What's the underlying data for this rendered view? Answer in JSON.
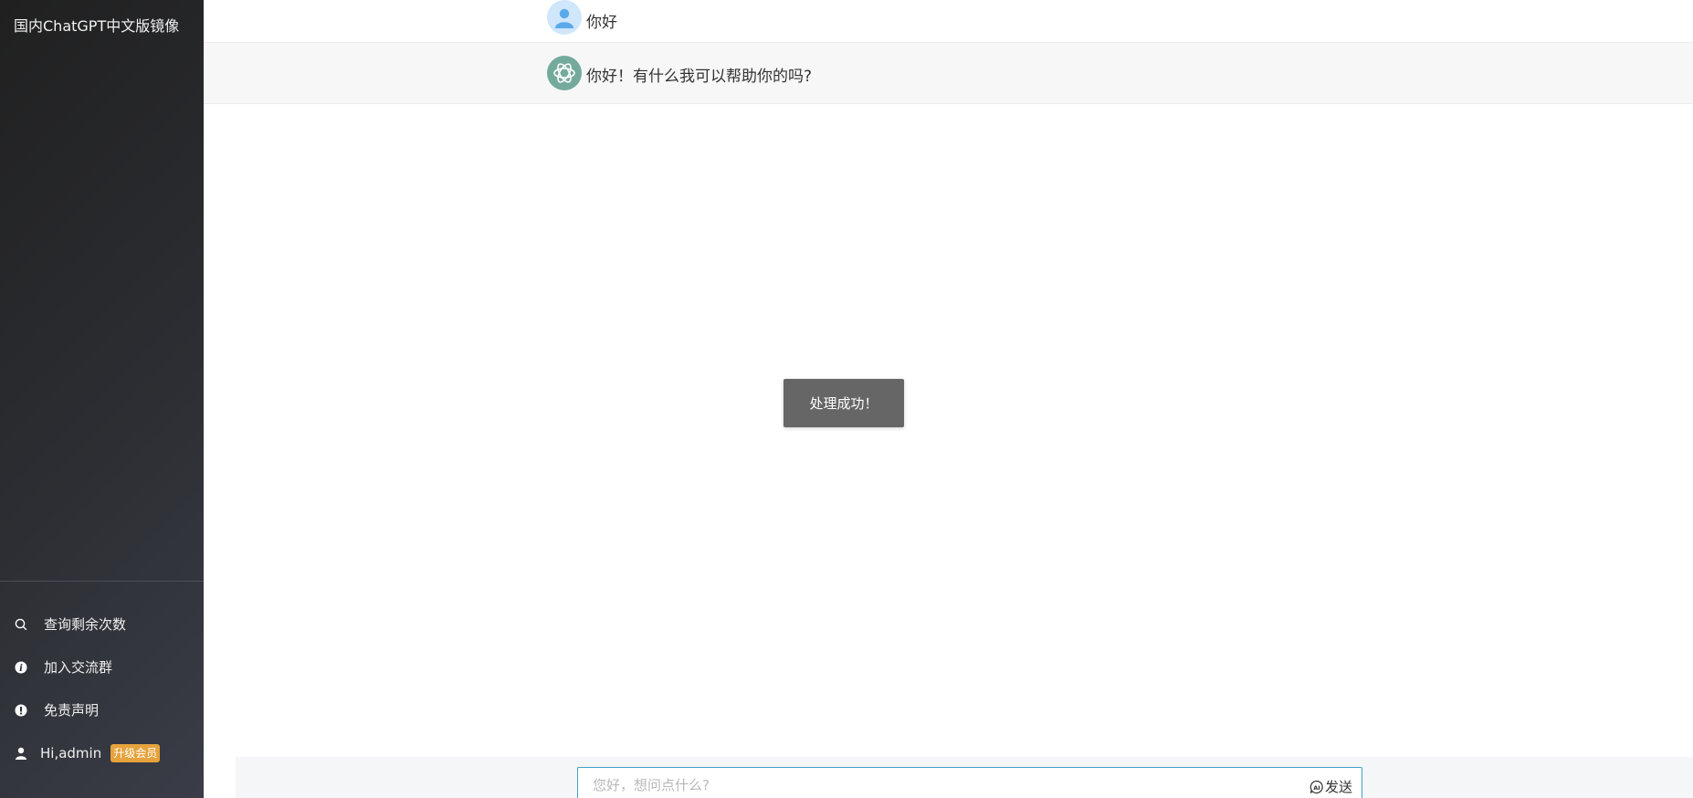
{
  "sidebar": {
    "title": "国内ChatGPT中文版镜像",
    "items": [
      {
        "label": "查询剩余次数",
        "icon": "search-icon"
      },
      {
        "label": "加入交流群",
        "icon": "info-icon"
      },
      {
        "label": "免责声明",
        "icon": "exclamation-icon"
      }
    ],
    "user": {
      "greeting": "Hi,admin",
      "badge": "升级会员",
      "icon": "user-icon"
    }
  },
  "messages": [
    {
      "role": "user",
      "text": "你好",
      "avatar": "user-avatar-icon"
    },
    {
      "role": "assistant",
      "text": "你好！有什么我可以帮助你的吗?",
      "avatar": "openai-logo-icon"
    }
  ],
  "toast": {
    "text": "处理成功！"
  },
  "composer": {
    "placeholder": "您好，想问点什么?",
    "send_label": "发送",
    "send_icon": "ai-chat-icon"
  },
  "colors": {
    "sidebar_bg": "#2c2e33",
    "badge": "#e6a23c",
    "bot_avatar": "#74aa9c",
    "user_avatar": "#cfe6fb",
    "input_border": "#41a1c3",
    "toast_bg": "#666666"
  }
}
